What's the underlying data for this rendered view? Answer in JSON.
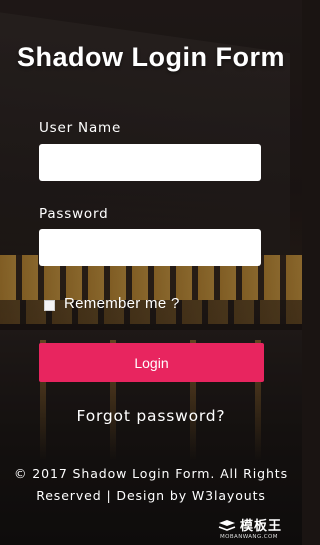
{
  "form": {
    "title": "Shadow Login Form",
    "username_label": "User Name",
    "username_value": "",
    "username_placeholder": "",
    "password_label": "Password",
    "password_value": "",
    "password_placeholder": "",
    "remember_label": "Remember me ?",
    "remember_checked": false,
    "login_label": "Login",
    "forgot_label": "Forgot password?"
  },
  "footer": {
    "line1": "© 2017 Shadow Login Form. All Rights",
    "line2_prefix": "Reserved | Design by ",
    "line2_link": "W3layouts"
  },
  "watermark": {
    "brand": "模板王",
    "domain": "MOBANWANG.COM"
  },
  "colors": {
    "accent": "#e8255f",
    "text": "#ffffff",
    "input_bg": "#ffffff"
  },
  "icons": {
    "watermark_logo": "moban-logo-icon"
  }
}
